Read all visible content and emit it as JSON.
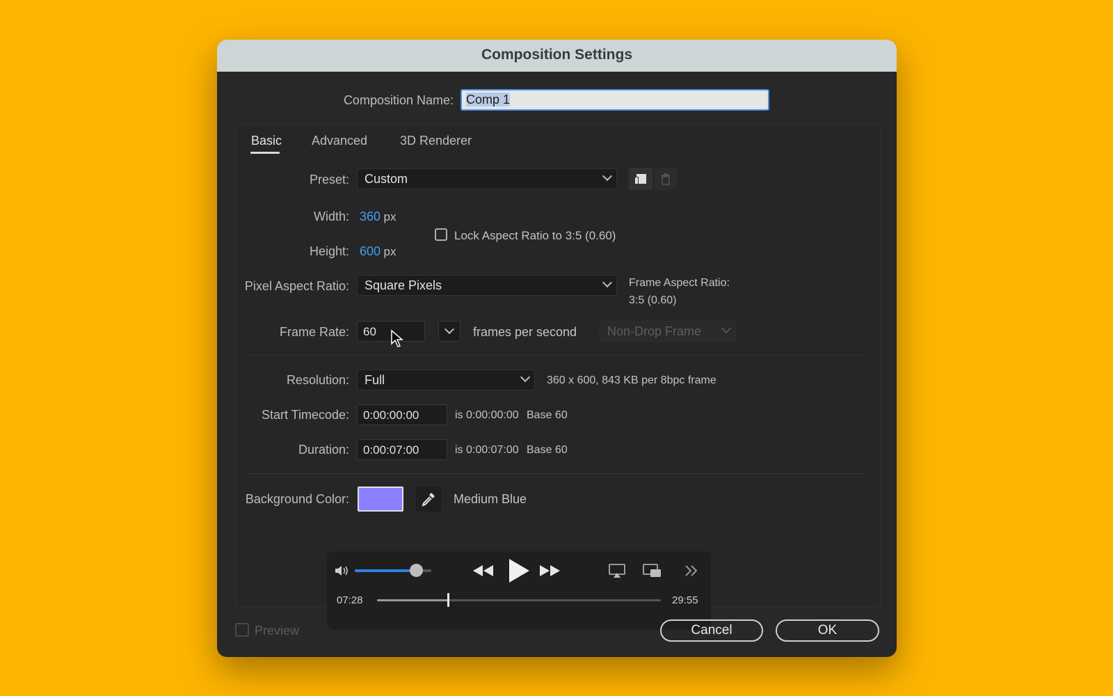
{
  "dialog": {
    "title": "Composition Settings",
    "comp_name_label": "Composition Name:",
    "comp_name_value": "Comp 1"
  },
  "tabs": [
    {
      "label": "Basic",
      "active": true
    },
    {
      "label": "Advanced",
      "active": false
    },
    {
      "label": "3D Renderer",
      "active": false
    }
  ],
  "basic": {
    "preset_label": "Preset:",
    "preset_value": "Custom",
    "width_label": "Width:",
    "width_value": "360",
    "width_unit": "px",
    "height_label": "Height:",
    "height_value": "600",
    "height_unit": "px",
    "lock_aspect_label": "Lock Aspect Ratio to 3:5 (0.60)",
    "pixel_aspect_label": "Pixel Aspect Ratio:",
    "pixel_aspect_value": "Square Pixels",
    "frame_aspect_label": "Frame Aspect Ratio:",
    "frame_aspect_value": "3:5 (0.60)",
    "frame_rate_label": "Frame Rate:",
    "frame_rate_value": "60",
    "frames_per_second": "frames per second",
    "drop_frame_value": "Non-Drop Frame",
    "resolution_label": "Resolution:",
    "resolution_value": "Full",
    "resolution_info": "360 x 600, 843 KB per 8bpc frame",
    "start_timecode_label": "Start Timecode:",
    "start_timecode_value": "0:00:00:00",
    "start_timecode_is": "is 0:00:00:00",
    "start_timecode_base": "Base 60",
    "duration_label": "Duration:",
    "duration_value": "0:00:07:00",
    "duration_is": "is 0:00:07:00",
    "duration_base": "Base 60",
    "bg_color_label": "Background Color:",
    "bg_color_name": "Medium Blue",
    "bg_color_hex": "#8A80FF"
  },
  "player": {
    "elapsed": "07:28",
    "total": "29:55",
    "volume_fraction": 0.8,
    "progress_fraction": 0.25
  },
  "footer": {
    "preview_label": "Preview",
    "cancel_label": "Cancel",
    "ok_label": "OK"
  },
  "colors": {
    "background": "#FDB400",
    "accent_blue": "#3EA0F2",
    "dialog": "#282828",
    "titlebar": "#CDD6D6"
  }
}
